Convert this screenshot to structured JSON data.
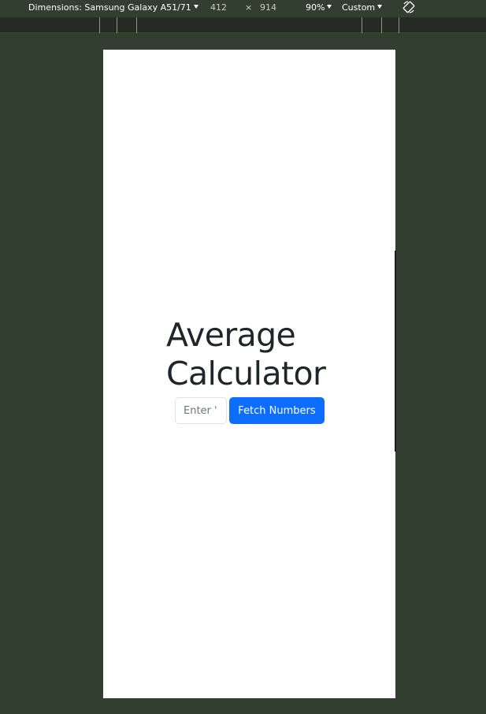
{
  "devtools": {
    "dimensions_label": "Dimensions: Samsung Galaxy A51/71",
    "width": "412",
    "times": "×",
    "height": "914",
    "zoom": "90%",
    "throttle": "Custom",
    "rotate_icon": "rotate-icon"
  },
  "page": {
    "title": "Average Calculator",
    "input_placeholder": "Enter '|",
    "fetch_button_label": "Fetch Numbers"
  },
  "colors": {
    "devtools_bg": "#323e2f",
    "button_primary": "#0d6efd",
    "heading_text": "#212529"
  }
}
